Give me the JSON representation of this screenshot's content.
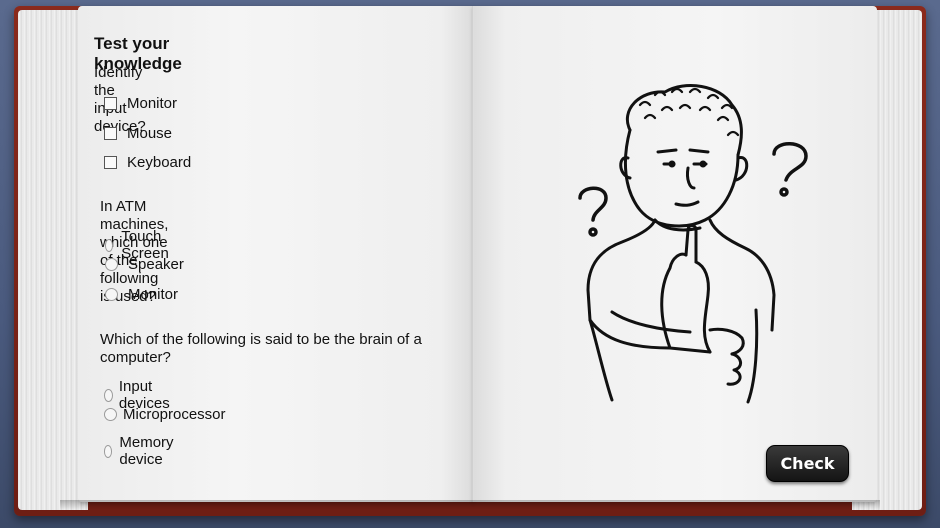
{
  "quiz": {
    "title": "Test your knowledge",
    "questions": [
      {
        "text": "Identify the input device?",
        "type": "checkbox",
        "options": [
          "Monitor",
          "Mouse",
          "Keyboard"
        ]
      },
      {
        "text": "In ATM machines, which one of the following is used?",
        "type": "radio",
        "options": [
          "Touch Screen",
          "Speaker",
          "Monitor"
        ]
      },
      {
        "text": "Which of the following is said to be the brain of a computer?",
        "type": "radio",
        "options": [
          "Input devices",
          "Microprocessor",
          "Memory device"
        ]
      }
    ]
  },
  "actions": {
    "check_label": "Check"
  },
  "illustration": {
    "icon": "thinking-boy-with-question-marks"
  }
}
